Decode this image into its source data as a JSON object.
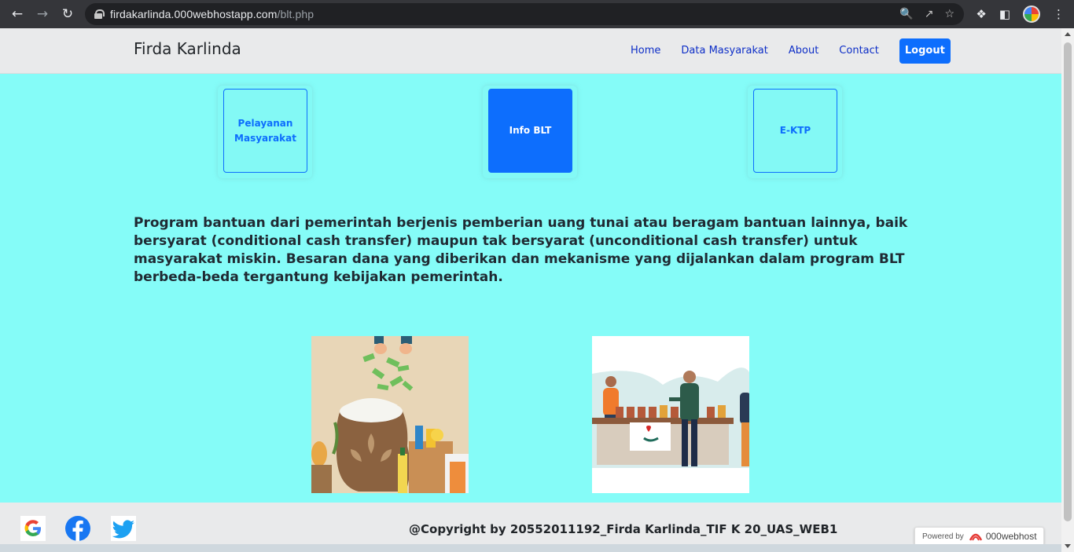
{
  "browser": {
    "url_host": "firdakarlinda.000webhostapp.com",
    "url_path": "/blt.php"
  },
  "navbar": {
    "brand": "Firda Karlinda",
    "links": [
      "Home",
      "Data Masyarakat",
      "About",
      "Contact"
    ],
    "logout": "Logout"
  },
  "cards": [
    {
      "label": "Pelayanan Masyarakat",
      "active": false
    },
    {
      "label": "Info BLT",
      "active": true
    },
    {
      "label": "E-KTP",
      "active": false
    }
  ],
  "description": "Program bantuan dari pemerintah berjenis pemberian uang tunai atau beragam bantuan lainnya, baik bersyarat (conditional cash transfer) maupun tak bersyarat (unconditional cash transfer) untuk masyarakat miskin. Besaran dana yang diberikan dan mekanisme yang dijalankan dalam program BLT berbeda-beda tergantung kebijakan pemerintah.",
  "footer": {
    "copyright": "@Copyright by 20552011192_Firda Karlinda_TIF K 20_UAS_WEB1",
    "social": [
      "google-icon",
      "facebook-icon",
      "twitter-icon"
    ],
    "powered_label": "Powered by",
    "powered_host": "000webhost"
  },
  "colors": {
    "page_bg": "#85fcf8",
    "accent": "#0d6efd",
    "navbar_bg": "#e9eaeb"
  }
}
